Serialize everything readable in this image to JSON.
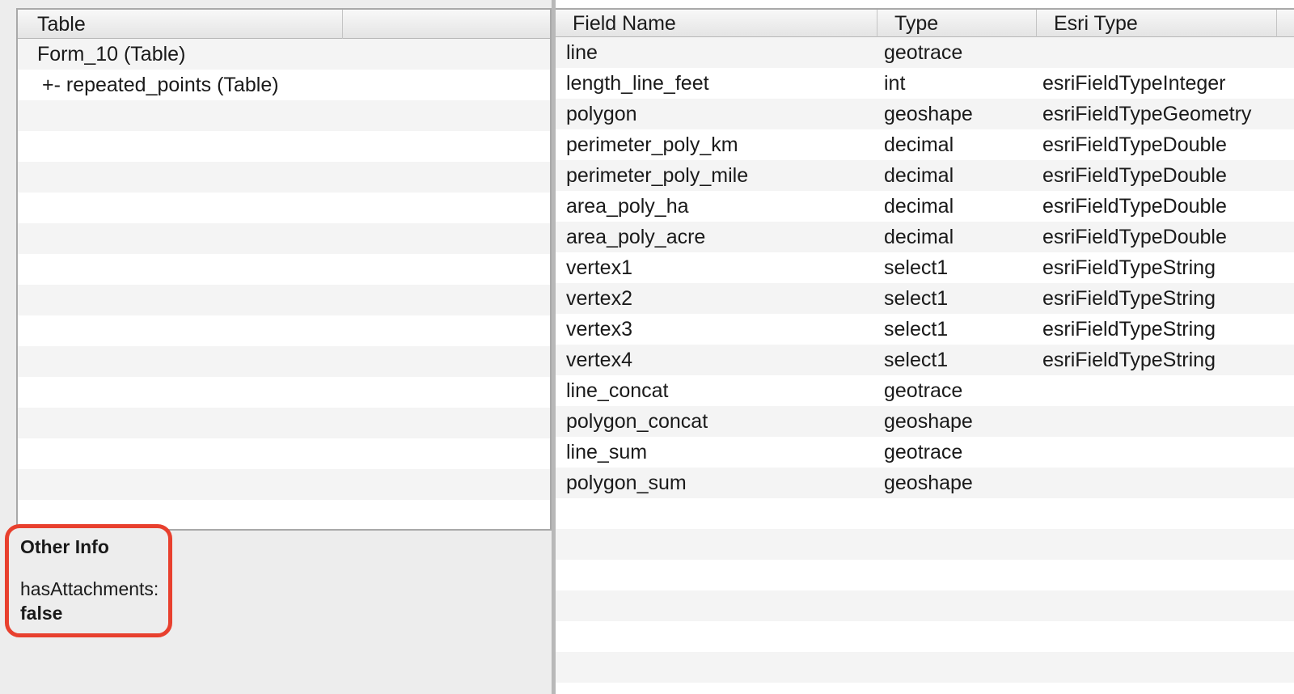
{
  "left_table": {
    "header": {
      "table": "Table",
      "extra": ""
    },
    "rows": [
      {
        "label": "Form_10 (Table)",
        "indent": false
      },
      {
        "label": "+- repeated_points (Table)",
        "indent": true
      },
      {
        "label": "",
        "indent": false
      },
      {
        "label": "",
        "indent": false
      },
      {
        "label": "",
        "indent": false
      },
      {
        "label": "",
        "indent": false
      },
      {
        "label": "",
        "indent": false
      },
      {
        "label": "",
        "indent": false
      },
      {
        "label": "",
        "indent": false
      },
      {
        "label": "",
        "indent": false
      },
      {
        "label": "",
        "indent": false
      },
      {
        "label": "",
        "indent": false
      },
      {
        "label": "",
        "indent": false
      },
      {
        "label": "",
        "indent": false
      },
      {
        "label": "",
        "indent": false
      },
      {
        "label": "",
        "indent": false
      }
    ]
  },
  "other_info": {
    "title": "Other Info",
    "attr_key": "hasAttachments:",
    "attr_value": "false",
    "highlight_color": "#e8402e"
  },
  "fields_table": {
    "headers": {
      "field_name": "Field Name",
      "type": "Type",
      "esri_type": "Esri Type"
    },
    "rows": [
      {
        "name": "line",
        "type": "geotrace",
        "esri": ""
      },
      {
        "name": "length_line_feet",
        "type": "int",
        "esri": "esriFieldTypeInteger"
      },
      {
        "name": "polygon",
        "type": "geoshape",
        "esri": "esriFieldTypeGeometry"
      },
      {
        "name": "perimeter_poly_km",
        "type": "decimal",
        "esri": "esriFieldTypeDouble"
      },
      {
        "name": "perimeter_poly_mile",
        "type": "decimal",
        "esri": "esriFieldTypeDouble"
      },
      {
        "name": "area_poly_ha",
        "type": "decimal",
        "esri": "esriFieldTypeDouble"
      },
      {
        "name": "area_poly_acre",
        "type": "decimal",
        "esri": "esriFieldTypeDouble"
      },
      {
        "name": "vertex1",
        "type": "select1",
        "esri": "esriFieldTypeString"
      },
      {
        "name": "vertex2",
        "type": "select1",
        "esri": "esriFieldTypeString"
      },
      {
        "name": "vertex3",
        "type": "select1",
        "esri": "esriFieldTypeString"
      },
      {
        "name": "vertex4",
        "type": "select1",
        "esri": "esriFieldTypeString"
      },
      {
        "name": "line_concat",
        "type": "geotrace",
        "esri": ""
      },
      {
        "name": "polygon_concat",
        "type": "geoshape",
        "esri": ""
      },
      {
        "name": "line_sum",
        "type": "geotrace",
        "esri": ""
      },
      {
        "name": "polygon_sum",
        "type": "geoshape",
        "esri": ""
      },
      {
        "name": "",
        "type": "",
        "esri": ""
      },
      {
        "name": "",
        "type": "",
        "esri": ""
      },
      {
        "name": "",
        "type": "",
        "esri": ""
      },
      {
        "name": "",
        "type": "",
        "esri": ""
      },
      {
        "name": "",
        "type": "",
        "esri": ""
      },
      {
        "name": "",
        "type": "",
        "esri": ""
      },
      {
        "name": "",
        "type": "",
        "esri": ""
      }
    ]
  }
}
